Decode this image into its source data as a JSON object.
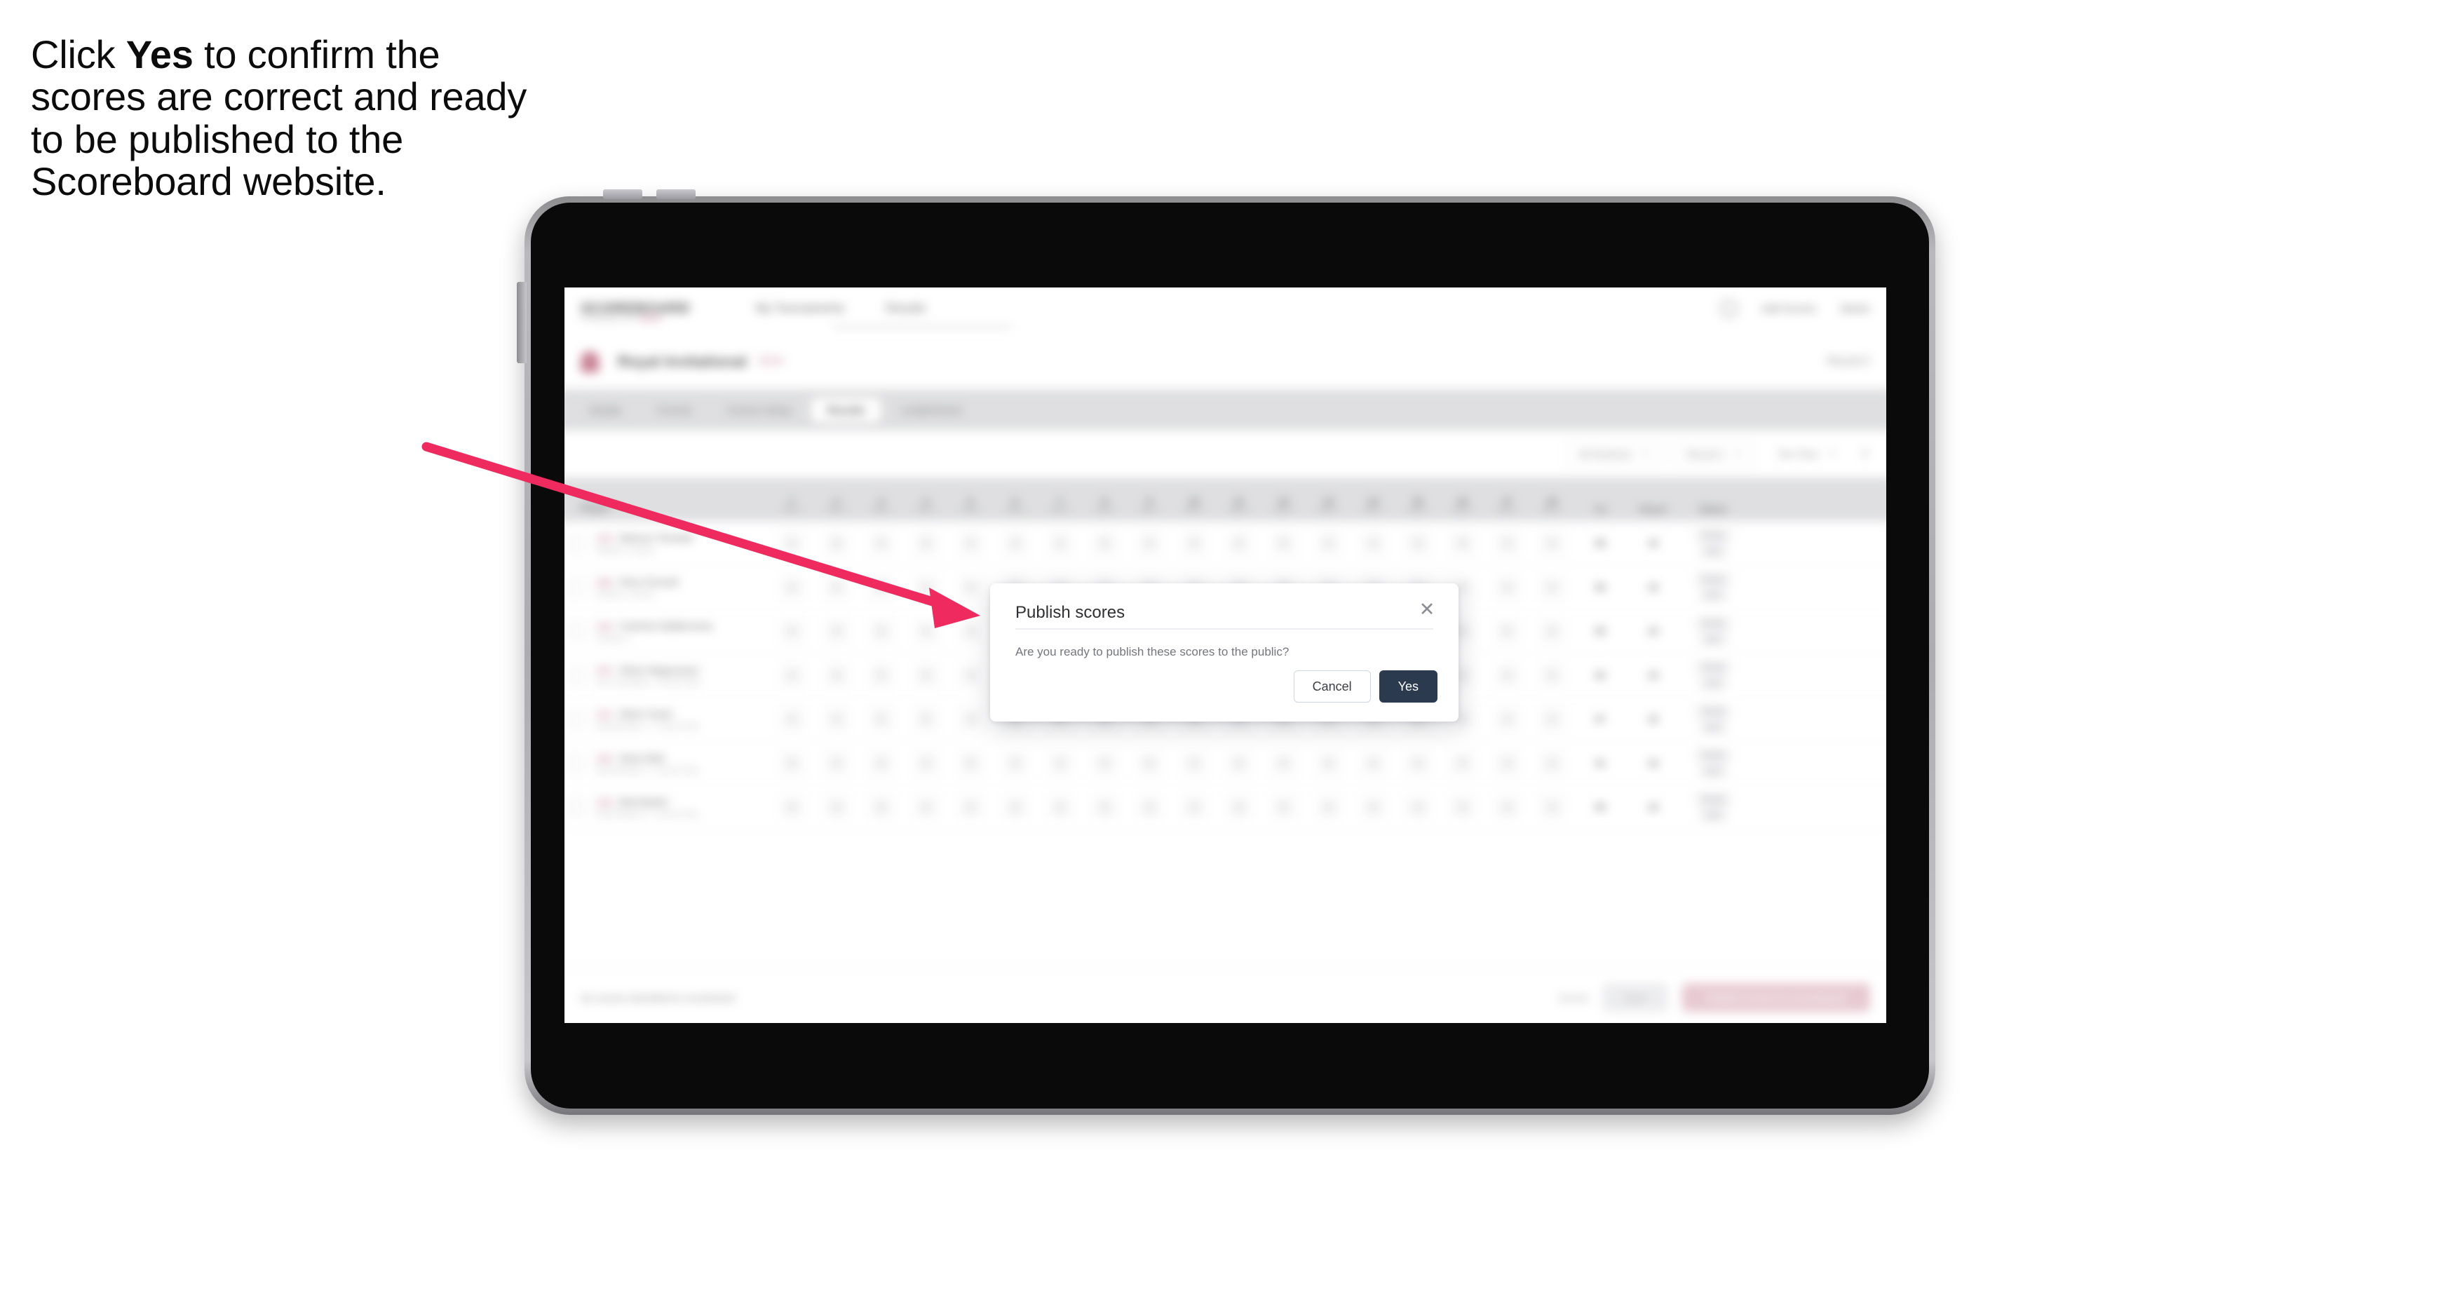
{
  "caption": {
    "before": "Click ",
    "bold": "Yes",
    "after": " to confirm the scores are correct and ready to be published to the Scoreboard website."
  },
  "annotation": {
    "arrow_color": "#ee2a5f"
  },
  "device": {
    "type": "tablet",
    "bezel_color": "#0a0a0a",
    "frame_color": "#b9b9bd"
  },
  "app": {
    "header": {
      "brand": "SCOREBOARD",
      "brand_sub": "POWERED BY",
      "brand_sub_dot": "GOLF",
      "nav": [
        "My Tournaments",
        "Results"
      ],
      "right_items": [
        "Add Scores",
        "Martin"
      ],
      "avatar_icon": "user-circle-icon"
    },
    "title_row": {
      "icon": "flag-icon",
      "title": "Royal Invitational",
      "badge": "2024",
      "right": "Round 2"
    },
    "tabs": [
      {
        "label": "Details",
        "active": false
      },
      {
        "label": "Format",
        "active": false
      },
      {
        "label": "Course Setup",
        "active": false
      },
      {
        "label": "Results",
        "active": true
      },
      {
        "label": "Leaderboard",
        "active": false
      }
    ],
    "toolbar": {
      "filter_label": "All Divisions",
      "round_label": "Round 2",
      "tee_label": "Tee Time",
      "caret_icon": "chevron-down-icon",
      "close_icon": "close-icon"
    },
    "table": {
      "headers": {
        "player": "Player",
        "holes": [
          {
            "n": "1",
            "par": "Par 4"
          },
          {
            "n": "2",
            "par": "Par 3"
          },
          {
            "n": "3",
            "par": "Par 5"
          },
          {
            "n": "4",
            "par": "Par 4"
          },
          {
            "n": "5",
            "par": "Par 4"
          },
          {
            "n": "6",
            "par": "Par 3"
          },
          {
            "n": "7",
            "par": "Par 4"
          },
          {
            "n": "8",
            "par": "Par 5"
          },
          {
            "n": "9",
            "par": "Par 4"
          },
          {
            "n": "10",
            "par": "Par 4"
          },
          {
            "n": "11",
            "par": "Par 3"
          },
          {
            "n": "12",
            "par": "Par 5"
          },
          {
            "n": "13",
            "par": "Par 4"
          },
          {
            "n": "14",
            "par": "Par 4"
          },
          {
            "n": "15",
            "par": "Par 3"
          },
          {
            "n": "16",
            "par": "Par 5"
          },
          {
            "n": "17",
            "par": "Par 4"
          },
          {
            "n": "18",
            "par": "Par 4"
          }
        ],
        "total": "Tot",
        "played": "Played",
        "status": "Status"
      },
      "rows": [
        {
          "hcp": "(12)",
          "name": "Mariusz Tomasik",
          "sub": "Division 1 Senior",
          "scores": [
            "4",
            "3",
            "5",
            "4",
            "4",
            "3",
            "4",
            "5",
            "4",
            "4",
            "3",
            "5",
            "4",
            "4",
            "3",
            "5",
            "4",
            "4"
          ],
          "total": "88",
          "played": "18",
          "status": [
            "Ready",
            "Sent"
          ]
        },
        {
          "hcp": "(09)",
          "name": "Piers Permell",
          "sub": "Division 1 Senior",
          "scores": [
            "4",
            "4",
            "5",
            "4",
            "5",
            "3",
            "4",
            "5",
            "4",
            "4",
            "3",
            "6",
            "4",
            "4",
            "3",
            "5",
            "4",
            "4"
          ],
          "total": "86",
          "played": "18",
          "status": [
            "Ready",
            "Sent"
          ]
        },
        {
          "hcp": "(14)",
          "name": "Casimiro Balderrama",
          "sub": "Division 1",
          "scores": [
            "5",
            "3",
            "5",
            "4",
            "4",
            "4",
            "4",
            "5",
            "4",
            "5",
            "3",
            "5",
            "4",
            "4",
            "3",
            "5",
            "5",
            "4"
          ],
          "total": "89",
          "played": "18",
          "status": [
            "Ready",
            "Sent"
          ]
        },
        {
          "hcp": "(07)",
          "name": "Oliver Magnusson",
          "sub": "Joe Cumulative - Course Only",
          "scores": [
            "4",
            "3",
            "5",
            "4",
            "4",
            "3",
            "4",
            "4",
            "4",
            "4",
            "3",
            "5",
            "4",
            "4",
            "3",
            "4",
            "4",
            "4"
          ],
          "total": "82",
          "played": "18",
          "status": [
            "Ready",
            "Sent"
          ]
        },
        {
          "hcp": "(11)",
          "name": "Oliver Grant",
          "sub": "Dual Division 1 - Course Only",
          "scores": [
            "4",
            "4",
            "5",
            "5",
            "4",
            "3",
            "4",
            "5",
            "4",
            "4",
            "3",
            "5",
            "4",
            "4",
            "4",
            "5",
            "4",
            "4"
          ],
          "total": "87",
          "played": "18",
          "status": [
            "Ready",
            "Sent"
          ]
        },
        {
          "hcp": "(16)",
          "name": "Sean Mott",
          "sub": "Dual Division 2 - Course Only",
          "scores": [
            "5",
            "4",
            "5",
            "4",
            "5",
            "3",
            "4",
            "5",
            "5",
            "4",
            "3",
            "5",
            "4",
            "4",
            "3",
            "5",
            "4",
            "4"
          ],
          "total": "91",
          "played": "18",
          "status": [
            "Ready",
            "Sent"
          ]
        },
        {
          "hcp": "(10)",
          "name": "Bob Barker",
          "sub": "Dual Division 2 - Course Only",
          "scores": [
            "4",
            "3",
            "5",
            "4",
            "4",
            "3",
            "4",
            "5",
            "4",
            "4",
            "3",
            "5",
            "4",
            "4",
            "3",
            "5",
            "4",
            "4"
          ],
          "total": "85",
          "played": "18",
          "status": [
            "Ready",
            "Sent"
          ]
        }
      ]
    },
    "footer": {
      "note": "No scores submitted to scoreboard",
      "link": "Cancel",
      "secondary_button": "Save",
      "primary_button": "Publish scores to scoreboard"
    }
  },
  "modal": {
    "title": "Publish scores",
    "body": "Are you ready to publish these scores to the public?",
    "close_icon": "close-icon",
    "cancel_label": "Cancel",
    "confirm_label": "Yes",
    "confirm_color": "#2b3a4f"
  }
}
